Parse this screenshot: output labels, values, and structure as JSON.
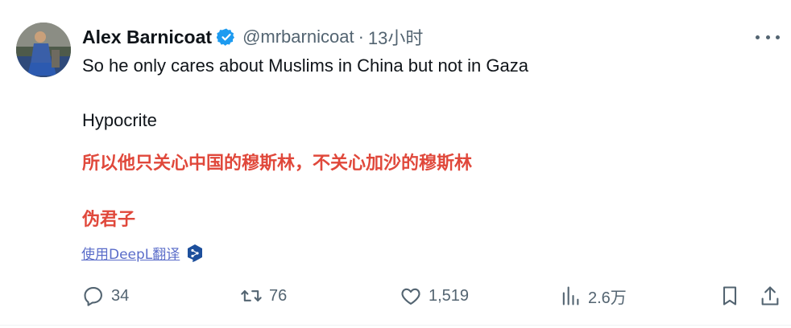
{
  "author": {
    "name": "Alex Barnicoat",
    "handle": "@mrbarnicoat",
    "separator": "·",
    "time": "13小时",
    "verified_color": "#1d9bf0"
  },
  "body": {
    "line1": "So he only cares about Muslims in China but not in Gaza",
    "line2": "Hypocrite"
  },
  "translation": {
    "line1": "所以他只关心中国的穆斯林，不关心加沙的穆斯林",
    "line2": "伪君子",
    "color": "#e0483b",
    "link_label": "使用DeepL翻译"
  },
  "actions": {
    "replies": "34",
    "retweets": "76",
    "likes": "1,519",
    "views": "2.6万"
  },
  "icons": [
    "more-icon",
    "verified-icon",
    "reply-icon",
    "retweet-icon",
    "like-icon",
    "views-icon",
    "bookmark-icon",
    "share-icon",
    "deepl-icon"
  ]
}
